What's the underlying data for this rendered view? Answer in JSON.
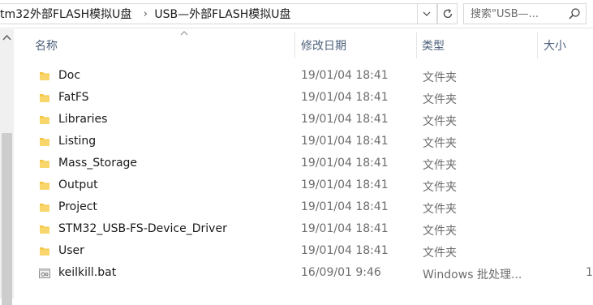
{
  "address": {
    "breadcrumbs": [
      "tm32外部FLASH模拟U盘",
      "USB—外部FLASH模拟U盘"
    ],
    "separator": "›"
  },
  "search": {
    "placeholder": "搜索\"USB—..."
  },
  "columns": {
    "name": "名称",
    "date": "修改日期",
    "type": "类型",
    "size": "大小"
  },
  "files": [
    {
      "name": "Doc",
      "date": "19/01/04 18:41",
      "type": "文件夹",
      "icon": "folder-icon"
    },
    {
      "name": "FatFS",
      "date": "19/01/04 18:41",
      "type": "文件夹",
      "icon": "folder-icon"
    },
    {
      "name": "Libraries",
      "date": "19/01/04 18:41",
      "type": "文件夹",
      "icon": "folder-icon"
    },
    {
      "name": "Listing",
      "date": "19/01/04 18:41",
      "type": "文件夹",
      "icon": "folder-icon"
    },
    {
      "name": "Mass_Storage",
      "date": "19/01/04 18:41",
      "type": "文件夹",
      "icon": "folder-icon"
    },
    {
      "name": "Output",
      "date": "19/01/04 18:41",
      "type": "文件夹",
      "icon": "folder-icon"
    },
    {
      "name": "Project",
      "date": "19/01/04 18:41",
      "type": "文件夹",
      "icon": "folder-icon"
    },
    {
      "name": "STM32_USB-FS-Device_Driver",
      "date": "19/01/04 18:41",
      "type": "文件夹",
      "icon": "folder-icon"
    },
    {
      "name": "User",
      "date": "19/01/04 18:41",
      "type": "文件夹",
      "icon": "folder-icon"
    },
    {
      "name": "keilkill.bat",
      "date": "16/09/01 9:46",
      "type": "Windows 批处理...",
      "size": "1",
      "icon": "batch-file-icon"
    }
  ],
  "colors": {
    "header_text": "#4c607a",
    "meta_text": "#6d6d6d",
    "folder": "#f4c542"
  }
}
